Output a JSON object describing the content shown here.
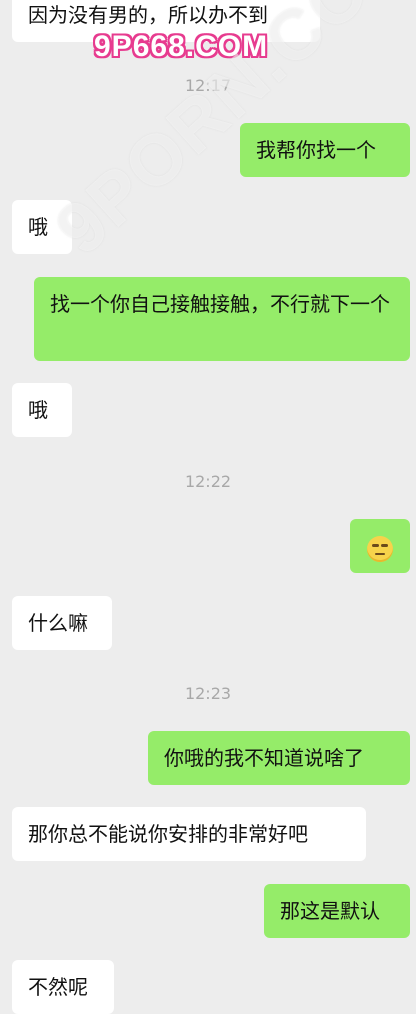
{
  "watermark": {
    "top": "9P668.COM",
    "diagonal": "9PORN.COM"
  },
  "messages": [
    {
      "side": "left",
      "text": "因为没有男的，所以办不到"
    },
    {
      "side": "right",
      "text": "我帮你找一个"
    },
    {
      "side": "left",
      "text": "哦"
    },
    {
      "side": "right",
      "text": "找一个你自己接触接触，不行就下一个"
    },
    {
      "side": "left",
      "text": "哦"
    },
    {
      "side": "right",
      "emoji": "rolling-eyes-emoji"
    },
    {
      "side": "left",
      "text": "什么嘛"
    },
    {
      "side": "right",
      "text": "你哦的我不知道说啥了"
    },
    {
      "side": "left",
      "text": "那你总不能说你安排的非常好吧"
    },
    {
      "side": "right",
      "text": "那这是默认"
    },
    {
      "side": "left",
      "text": "不然呢"
    }
  ],
  "timestamps": [
    "12:17",
    "12:22",
    "12:23"
  ]
}
